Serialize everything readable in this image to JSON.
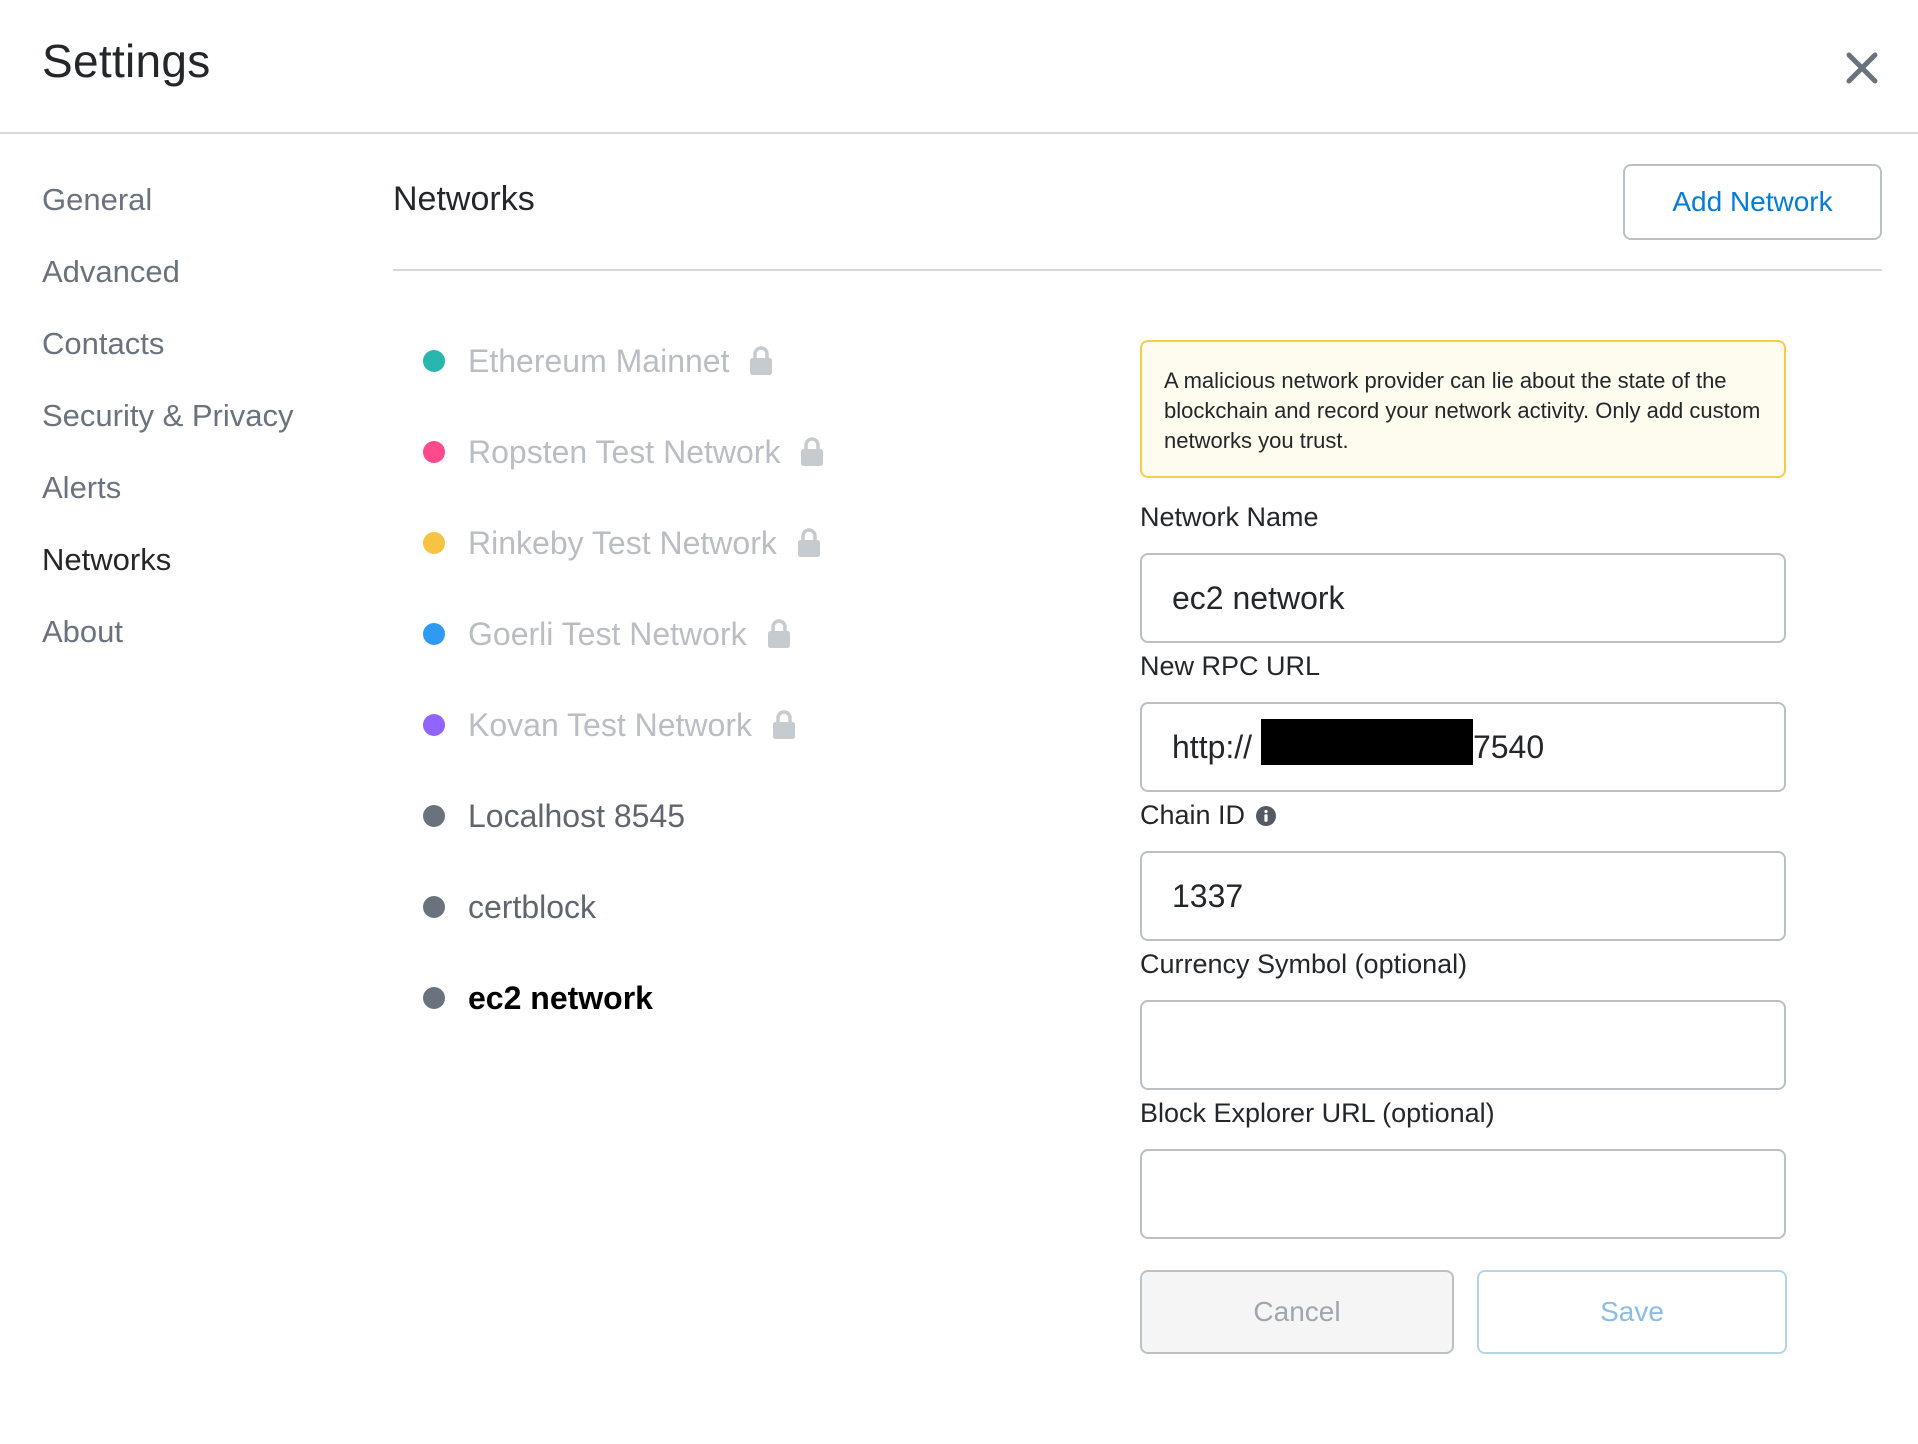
{
  "header": {
    "title": "Settings"
  },
  "sidebar": {
    "items": [
      {
        "label": "General"
      },
      {
        "label": "Advanced"
      },
      {
        "label": "Contacts"
      },
      {
        "label": "Security & Privacy"
      },
      {
        "label": "Alerts"
      },
      {
        "label": "Networks",
        "active": true
      },
      {
        "label": "About"
      }
    ]
  },
  "networks_section": {
    "title": "Networks",
    "add_network_label": "Add Network"
  },
  "network_list": [
    {
      "label": "Ethereum Mainnet",
      "color": "#29b6af",
      "locked": true
    },
    {
      "label": "Ropsten Test Network",
      "color": "#ff4a8d",
      "locked": true
    },
    {
      "label": "Rinkeby Test Network",
      "color": "#f6c343",
      "locked": true
    },
    {
      "label": "Goerli Test Network",
      "color": "#3099f2",
      "locked": true
    },
    {
      "label": "Kovan Test Network",
      "color": "#9064ff",
      "locked": true
    },
    {
      "label": "Localhost 8545",
      "color": "#6a737d",
      "locked": false
    },
    {
      "label": "certblock",
      "color": "#6a737d",
      "locked": false
    },
    {
      "label": "ec2 network",
      "color": "#6a737d",
      "locked": false,
      "selected": true
    }
  ],
  "form": {
    "warning": "A malicious network provider can lie about the state of the blockchain and record your network activity. Only add custom networks you trust.",
    "network_name_label": "Network Name",
    "network_name_value": "ec2 network",
    "rpc_url_label": "New RPC URL",
    "rpc_url_prefix": "http://",
    "rpc_url_suffix": ":7540",
    "chain_id_label": "Chain ID",
    "chain_id_value": "1337",
    "currency_symbol_label": "Currency Symbol (optional)",
    "currency_symbol_value": "",
    "block_explorer_label": "Block Explorer URL (optional)",
    "block_explorer_value": "",
    "cancel_label": "Cancel",
    "save_label": "Save"
  },
  "icons": {
    "close": "close-icon",
    "lock": "lock-icon",
    "info": "info-icon"
  },
  "colors": {
    "accent_blue": "#037dd6",
    "warning_border": "#f4ce4b",
    "warning_bg": "#fefcef"
  }
}
